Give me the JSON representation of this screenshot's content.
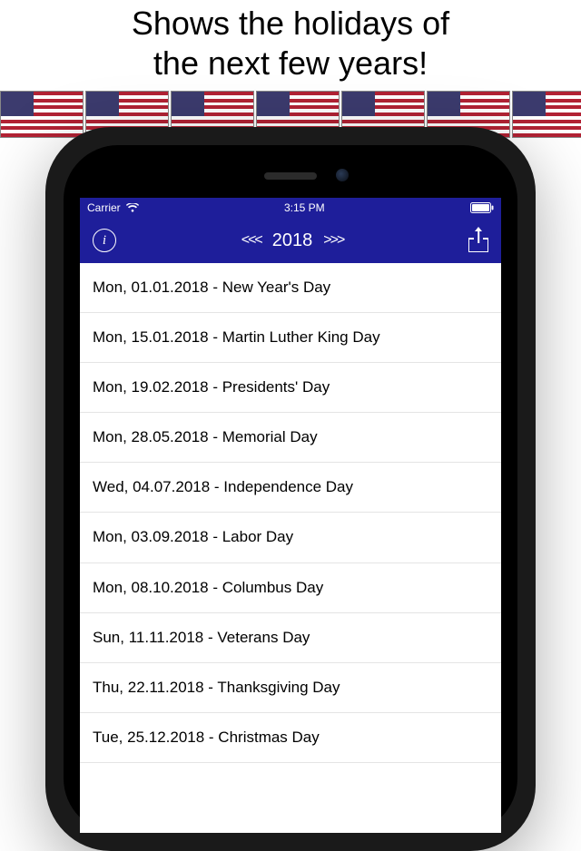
{
  "headline_line1": "Shows the holidays of",
  "headline_line2": "the next few years!",
  "status_bar": {
    "carrier": "Carrier",
    "time": "3:15 PM"
  },
  "nav": {
    "prev": "<<<",
    "year": "2018",
    "next": ">>>"
  },
  "holidays": [
    {
      "text": "Mon, 01.01.2018 - New Year's Day"
    },
    {
      "text": "Mon, 15.01.2018 - Martin Luther King Day"
    },
    {
      "text": "Mon, 19.02.2018 - Presidents' Day"
    },
    {
      "text": "Mon, 28.05.2018 - Memorial Day"
    },
    {
      "text": "Wed, 04.07.2018 - Independence Day"
    },
    {
      "text": "Mon, 03.09.2018 - Labor Day"
    },
    {
      "text": "Mon, 08.10.2018 - Columbus Day"
    },
    {
      "text": "Sun, 11.11.2018 - Veterans Day"
    },
    {
      "text": "Thu, 22.11.2018 - Thanksgiving Day"
    },
    {
      "text": "Tue, 25.12.2018 - Christmas Day"
    }
  ]
}
